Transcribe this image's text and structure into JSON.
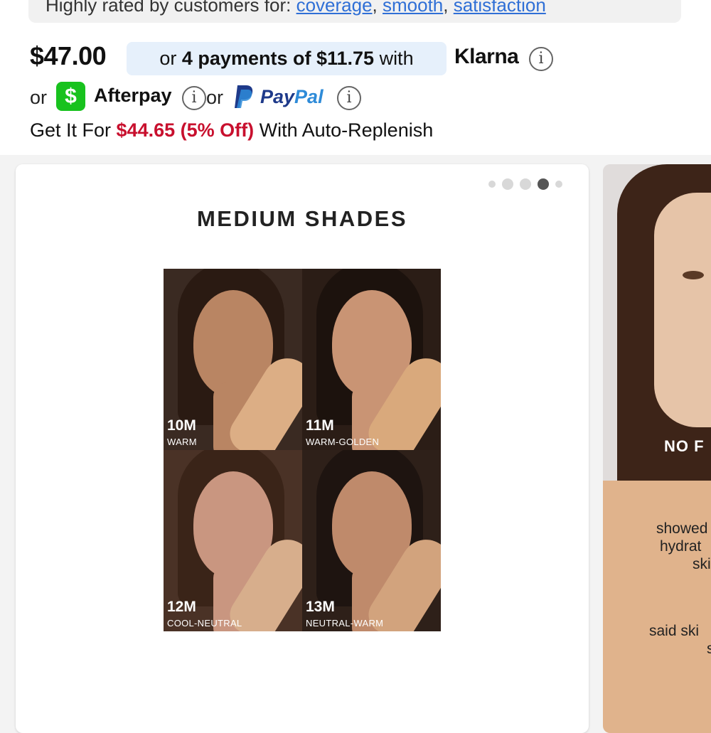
{
  "rated": {
    "prefix": "Highly rated by customers for: ",
    "links": [
      "coverage",
      "smooth",
      "satisfaction"
    ]
  },
  "pricing": {
    "price": "$47.00",
    "klarna_prefix": "or ",
    "klarna_bold": "4 payments of $11.75",
    "klarna_suffix": " with",
    "klarna_logo": "Klarna",
    "or_1": "or",
    "cashapp_symbol": "$",
    "afterpay": "Afterpay",
    "or_2": "or",
    "paypal_pay": "Pay",
    "paypal_pal": "Pal",
    "replenish_prefix": "Get It For ",
    "replenish_highlight": "$44.65 (5% Off)",
    "replenish_suffix": " With Auto-Replenish",
    "info_glyph": "i"
  },
  "carousel": {
    "title": "MEDIUM SHADES",
    "dots": 5,
    "active_dot": 3,
    "shades": [
      {
        "code": "10M",
        "tone": "WARM",
        "skin": "#b98563",
        "hair": "#2a1a12",
        "swatch": "#dcae85",
        "bg": "#3a2a22"
      },
      {
        "code": "11M",
        "tone": "WARM-GOLDEN",
        "skin": "#c99474",
        "hair": "#1c120d",
        "swatch": "#d9a97c",
        "bg": "#2b1d16"
      },
      {
        "code": "12M",
        "tone": "COOL-NEUTRAL",
        "skin": "#c99680",
        "hair": "#3a2418",
        "swatch": "#d7ae8c",
        "bg": "#4a3226"
      },
      {
        "code": "13M",
        "tone": "NEUTRAL-WARM",
        "skin": "#bf8a6b",
        "hair": "#1e1410",
        "swatch": "#d2a37d",
        "bg": "#2e2019"
      }
    ]
  },
  "next_card": {
    "label": "NO F",
    "lines": [
      "showed",
      "hydrat",
      "ski",
      "said ski",
      "s"
    ]
  }
}
